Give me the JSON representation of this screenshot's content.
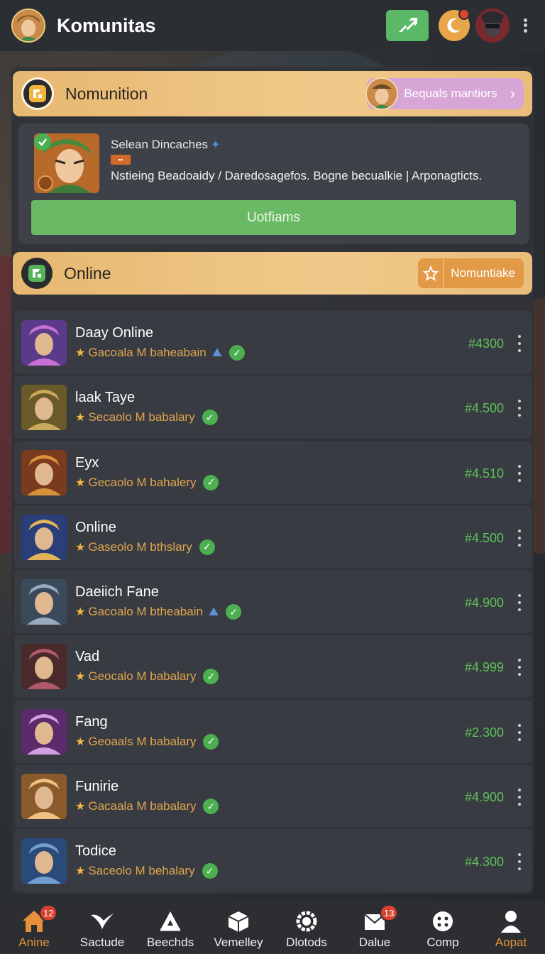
{
  "header": {
    "title": "Komunitas",
    "menu_icon": "kebab-icon"
  },
  "featured_section": {
    "title": "Nomunition",
    "action_label": "Bequals mantiors"
  },
  "featured_card": {
    "name": "Selean Dincaches",
    "tag": "▪▪",
    "description": "Nstieing Beadoaidy / Daredosagefos. Bogne becualkie | Arponagticts.",
    "button_label": "Uotfiams"
  },
  "online_section": {
    "title": "Online",
    "action_label": "Nomuntiake"
  },
  "players": [
    {
      "name": "Daay Online",
      "subtitle": "Gacoala M baheabain",
      "price": "#4300",
      "extra": "mountain",
      "colors": [
        "#5b3a8a",
        "#c86fd6"
      ]
    },
    {
      "name": "laak Taye",
      "subtitle": "Secaolo M babalary",
      "price": "#4.500",
      "extra": "",
      "colors": [
        "#6a5a2a",
        "#c8a85a"
      ]
    },
    {
      "name": "Eyx",
      "subtitle": "Gecaolo M bahalery",
      "price": "#4.510",
      "extra": "",
      "colors": [
        "#7a3a1e",
        "#d8913a"
      ]
    },
    {
      "name": "Online",
      "subtitle": "Gaseolo M bthslary",
      "price": "#4.500",
      "extra": "",
      "colors": [
        "#2a3f7a",
        "#e0b35a"
      ]
    },
    {
      "name": "Daeiich Fane",
      "subtitle": "Gacoalo M btheabain",
      "price": "#4.900",
      "extra": "mountain",
      "colors": [
        "#3a4a5a",
        "#9aaac0"
      ]
    },
    {
      "name": "Vad",
      "subtitle": "Geocalo M babalary",
      "price": "#4.999",
      "extra": "",
      "colors": [
        "#4a2a2a",
        "#b05a6a"
      ]
    },
    {
      "name": "Fang",
      "subtitle": "Geoaals M babalary",
      "price": "#2.300",
      "extra": "",
      "colors": [
        "#5a2a6a",
        "#d0a0e0"
      ]
    },
    {
      "name": "Funirie",
      "subtitle": "Gacaala M babalary",
      "price": "#4.900",
      "extra": "",
      "colors": [
        "#8a5a2a",
        "#f0c080"
      ]
    },
    {
      "name": "Todice",
      "subtitle": "Saceolo M behalary",
      "price": "#4.300",
      "extra": "",
      "colors": [
        "#2a4a7a",
        "#70a0d0"
      ]
    }
  ],
  "bottom_nav": [
    {
      "label": "Anine",
      "icon": "home-icon",
      "badge": "12",
      "active": true
    },
    {
      "label": "Sactude",
      "icon": "bird-icon",
      "badge": "",
      "active": false
    },
    {
      "label": "Beechds",
      "icon": "camping-icon",
      "badge": "",
      "active": false
    },
    {
      "label": "Vemelley",
      "icon": "cube-icon",
      "badge": "",
      "active": false
    },
    {
      "label": "Dlotods",
      "icon": "gear-ring-icon",
      "badge": "",
      "active": false
    },
    {
      "label": "Dalue",
      "icon": "mail-icon",
      "badge": "13",
      "active": false
    },
    {
      "label": "Comp",
      "icon": "dots-circle-icon",
      "badge": "",
      "active": false
    },
    {
      "label": "Aopat",
      "icon": "user-icon",
      "badge": "",
      "active": true
    }
  ],
  "colors": {
    "accent": "#e7b870",
    "green": "#5bb866",
    "price_green": "#5fc05a",
    "subtitle_orange": "#e0a54f"
  }
}
